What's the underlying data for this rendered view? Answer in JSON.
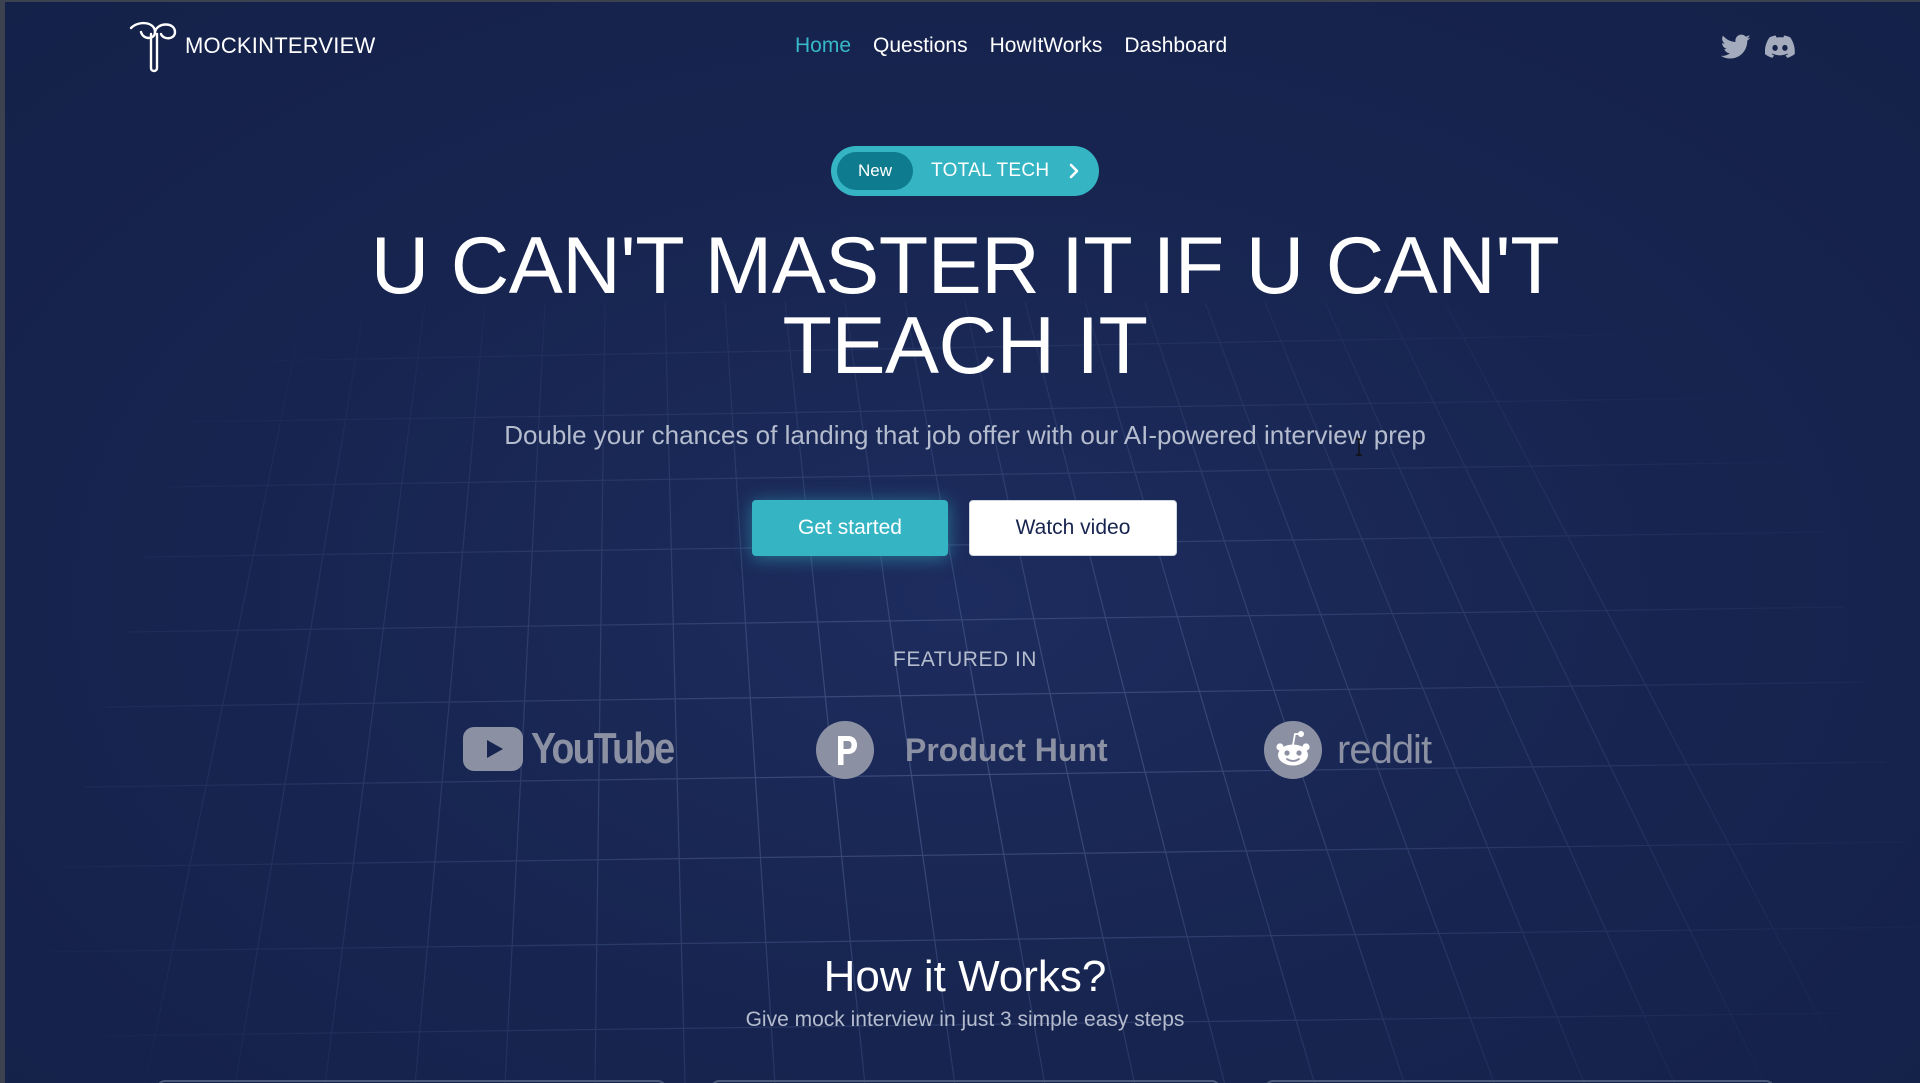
{
  "brand": {
    "name": "MOCKINTERVIEW"
  },
  "nav": {
    "items": [
      {
        "label": "Home",
        "active": true
      },
      {
        "label": "Questions",
        "active": false
      },
      {
        "label": "HowItWorks",
        "active": false
      },
      {
        "label": "Dashboard",
        "active": false
      }
    ]
  },
  "social": {
    "icons": [
      "twitter-icon",
      "discord-icon"
    ]
  },
  "badge": {
    "tag": "New",
    "text": "TOTAL TECH",
    "icon": "chevron-right-icon"
  },
  "hero": {
    "title_line1": "U CAN'T MASTER IT IF U CAN'T",
    "title_line2": "TEACH IT",
    "subtitle": "Double your chances of landing that job offer with our AI-powered interview prep",
    "primary_cta": "Get started",
    "secondary_cta": "Watch video"
  },
  "featured": {
    "label": "FEATURED IN",
    "logos": [
      {
        "name": "YouTube",
        "icon": "youtube-icon"
      },
      {
        "name": "Product Hunt",
        "icon": "product-hunt-icon"
      },
      {
        "name": "reddit",
        "icon": "reddit-icon"
      }
    ]
  },
  "how_it_works": {
    "title": "How it Works?",
    "subtitle": "Give mock interview in just 3 simple easy steps"
  },
  "colors": {
    "background": "#17244f",
    "accent": "#35b4c4",
    "badge_tag": "#0e7b8f",
    "muted_text": "#b4bccd",
    "logo_gray": "#8b91a3"
  }
}
